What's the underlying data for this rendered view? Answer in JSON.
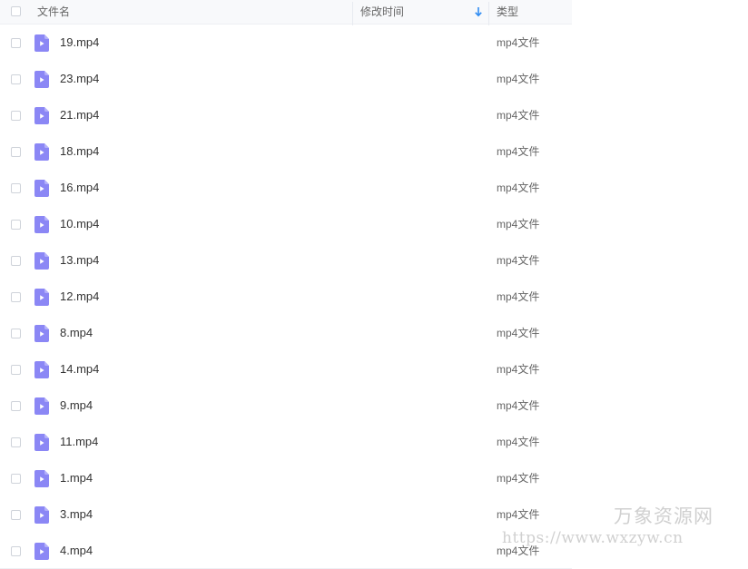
{
  "header": {
    "name_label": "文件名",
    "modified_label": "修改时间",
    "type_label": "类型",
    "sort_icon": "arrow-down-icon"
  },
  "file_icon": "video-file-icon",
  "files": [
    {
      "name": "19.mp4",
      "modified": "",
      "type": "mp4文件"
    },
    {
      "name": "23.mp4",
      "modified": "",
      "type": "mp4文件"
    },
    {
      "name": "21.mp4",
      "modified": "",
      "type": "mp4文件"
    },
    {
      "name": "18.mp4",
      "modified": "",
      "type": "mp4文件"
    },
    {
      "name": "16.mp4",
      "modified": "",
      "type": "mp4文件"
    },
    {
      "name": "10.mp4",
      "modified": "",
      "type": "mp4文件"
    },
    {
      "name": "13.mp4",
      "modified": "",
      "type": "mp4文件"
    },
    {
      "name": "12.mp4",
      "modified": "",
      "type": "mp4文件"
    },
    {
      "name": "8.mp4",
      "modified": "",
      "type": "mp4文件"
    },
    {
      "name": "14.mp4",
      "modified": "",
      "type": "mp4文件"
    },
    {
      "name": "9.mp4",
      "modified": "",
      "type": "mp4文件"
    },
    {
      "name": "11.mp4",
      "modified": "",
      "type": "mp4文件"
    },
    {
      "name": "1.mp4",
      "modified": "",
      "type": "mp4文件"
    },
    {
      "name": "3.mp4",
      "modified": "",
      "type": "mp4文件"
    },
    {
      "name": "4.mp4",
      "modified": "",
      "type": "mp4文件"
    }
  ],
  "watermark": {
    "line1": "万象资源网",
    "line2": "https://www.wxzyw.cn"
  },
  "colors": {
    "icon_accent": "#8b87f5",
    "icon_play": "#ffffff",
    "sort_arrow": "#2f8cf2"
  }
}
